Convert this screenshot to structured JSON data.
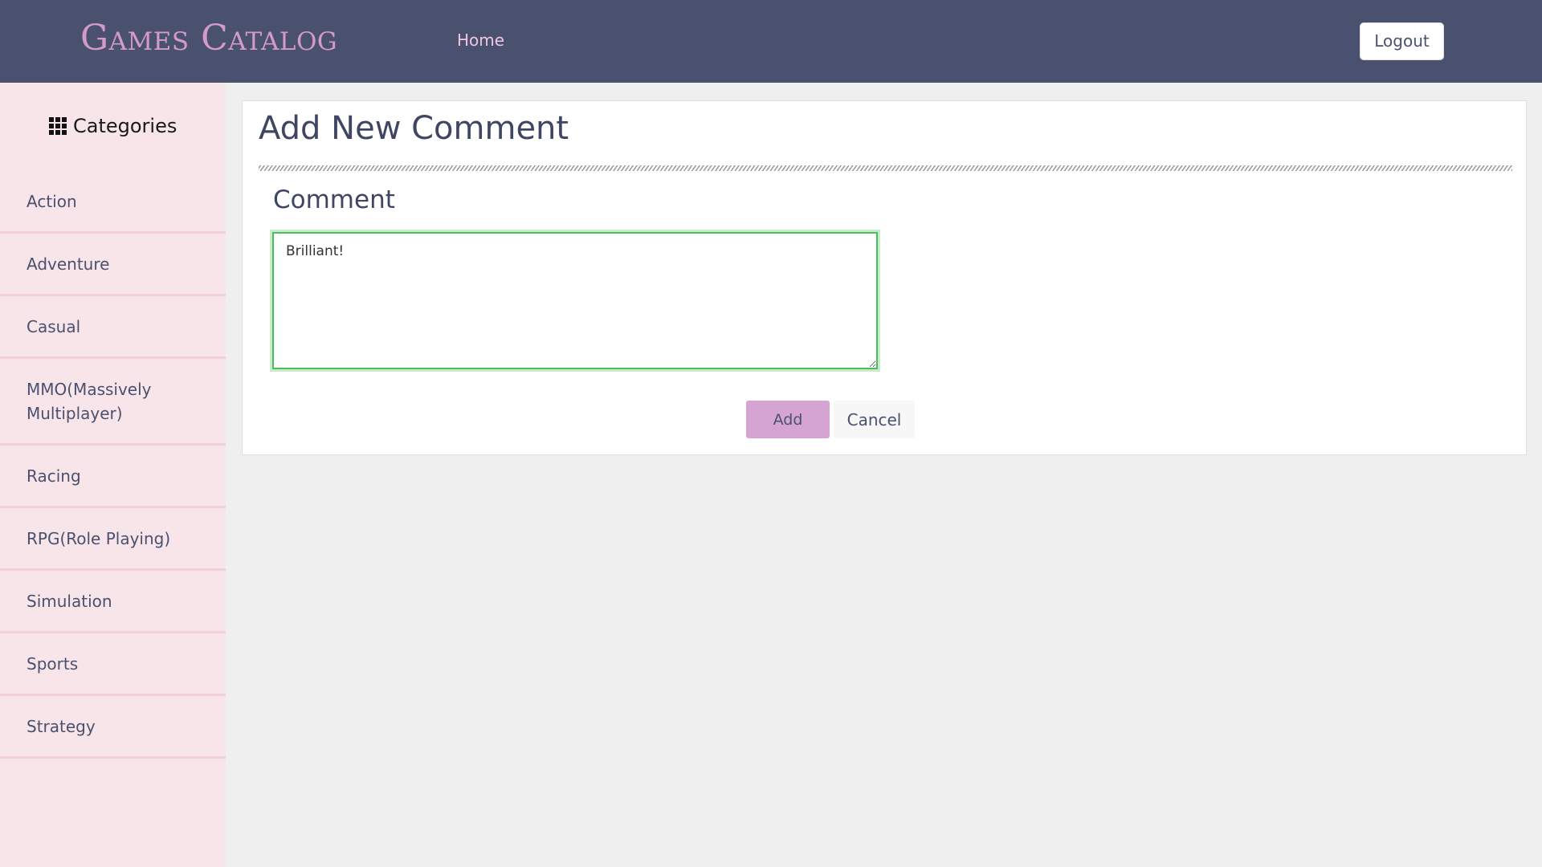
{
  "header": {
    "brand": "Games Catalog",
    "nav_home": "Home",
    "logout_label": "Logout"
  },
  "sidebar": {
    "icon": "grid-icon",
    "title": "Categories",
    "items": [
      {
        "label": "Action"
      },
      {
        "label": "Adventure"
      },
      {
        "label": "Casual"
      },
      {
        "label": "MMO(Massively Multiplayer)"
      },
      {
        "label": "Racing"
      },
      {
        "label": "RPG(Role Playing)"
      },
      {
        "label": "Simulation"
      },
      {
        "label": "Sports"
      },
      {
        "label": "Strategy"
      }
    ]
  },
  "main": {
    "title": "Add New Comment",
    "comment_label": "Comment",
    "comment_value": "Brilliant!",
    "add_label": "Add",
    "cancel_label": "Cancel"
  },
  "colors": {
    "header_bg": "#4a516f",
    "brand": "#d49ac9",
    "sidebar_bg": "#f8e5e9",
    "accent_button": "#d5a4d3",
    "focus_border": "#4cbc5c"
  }
}
